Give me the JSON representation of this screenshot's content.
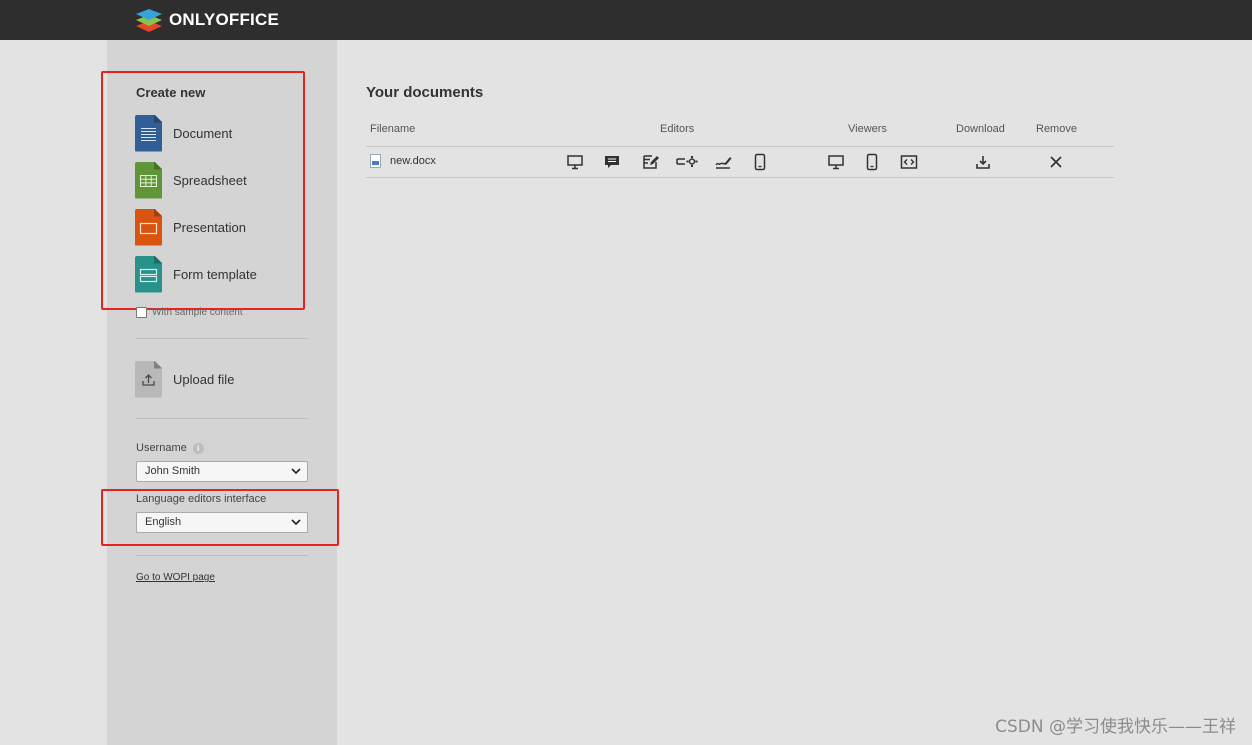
{
  "app": {
    "brand": "ONLYOFFICE"
  },
  "sidebar": {
    "create_title": "Create new",
    "create_items": [
      {
        "label": "Document",
        "icon": "document-file-icon",
        "color": "#2f5f96"
      },
      {
        "label": "Spreadsheet",
        "icon": "spreadsheet-file-icon",
        "color": "#5f9637"
      },
      {
        "label": "Presentation",
        "icon": "presentation-file-icon",
        "color": "#d9550f"
      },
      {
        "label": "Form template",
        "icon": "form-template-file-icon",
        "color": "#27918a"
      }
    ],
    "sample_content_label": "With sample content",
    "sample_content_checked": false,
    "upload_label": "Upload file",
    "username_label": "Username",
    "username_value": "John Smith",
    "language_label": "Language editors interface",
    "language_value": "English",
    "wopi_link": "Go to WOPI page"
  },
  "main": {
    "title": "Your documents",
    "columns": {
      "filename": "Filename",
      "editors": "Editors",
      "viewers": "Viewers",
      "download": "Download",
      "remove": "Remove"
    },
    "rows": [
      {
        "filename": "new.docx"
      }
    ],
    "editor_actions": [
      "desktop-edit-icon",
      "comment-icon",
      "review-icon",
      "fill-forms-icon",
      "sign-icon",
      "mobile-edit-icon"
    ],
    "viewer_actions": [
      "desktop-view-icon",
      "mobile-view-icon",
      "embedded-view-icon"
    ]
  },
  "watermark": "CSDN @学习使我快乐——王祥",
  "colors": {
    "topbar": "#2e2e2e",
    "sidebar": "#d4d4d4",
    "highlight": "#e8231f"
  }
}
